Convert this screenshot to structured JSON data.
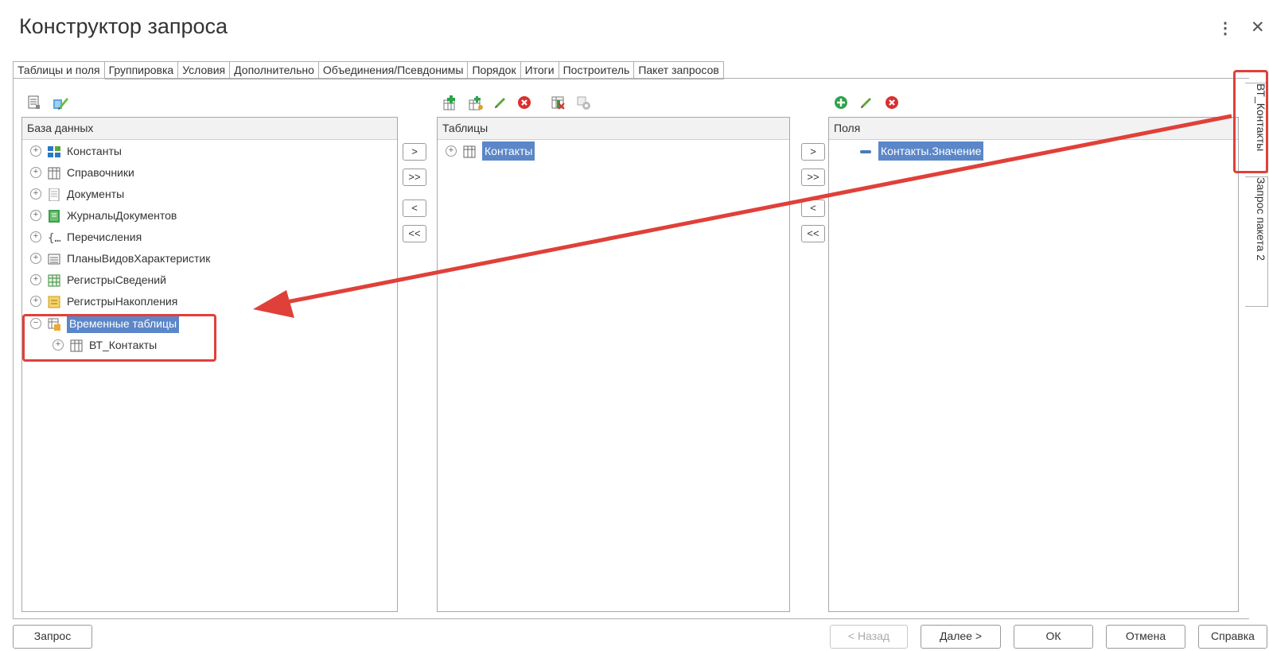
{
  "window": {
    "title": "Конструктор запроса"
  },
  "tabs": [
    {
      "label": "Таблицы и поля"
    },
    {
      "label": "Группировка"
    },
    {
      "label": "Условия"
    },
    {
      "label": "Дополнительно"
    },
    {
      "label": "Объединения/Псевдонимы"
    },
    {
      "label": "Порядок"
    },
    {
      "label": "Итоги"
    },
    {
      "label": "Построитель"
    },
    {
      "label": "Пакет запросов"
    }
  ],
  "database_panel": {
    "header": "База данных",
    "items": [
      {
        "label": "Константы",
        "icon": "constants-icon"
      },
      {
        "label": "Справочники",
        "icon": "catalog-icon"
      },
      {
        "label": "Документы",
        "icon": "document-icon"
      },
      {
        "label": "ЖурналыДокументов",
        "icon": "journal-icon"
      },
      {
        "label": "Перечисления",
        "icon": "enum-icon"
      },
      {
        "label": "ПланыВидовХарактеристик",
        "icon": "characteristics-icon"
      },
      {
        "label": "РегистрыСведений",
        "icon": "info-register-icon"
      },
      {
        "label": "РегистрыНакопления",
        "icon": "accum-register-icon"
      },
      {
        "label": "Временные таблицы",
        "icon": "temp-tables-icon",
        "expanded": true,
        "selected": true
      },
      {
        "label": "ВТ_Контакты",
        "icon": "table-icon",
        "child": true
      }
    ]
  },
  "tables_panel": {
    "header": "Таблицы",
    "items": [
      {
        "label": "Контакты",
        "selected": true
      }
    ]
  },
  "fields_panel": {
    "header": "Поля",
    "items": [
      {
        "label": "Контакты.Значение",
        "selected": true
      }
    ]
  },
  "transfer_buttons": {
    "add": ">",
    "add_all": ">>",
    "remove": "<",
    "remove_all": "<<"
  },
  "side_tabs": [
    {
      "label": "ВТ_Контакты",
      "active": true
    },
    {
      "label": "Запрос пакета 2"
    }
  ],
  "footer": {
    "query": "Запрос",
    "back": "< Назад",
    "next": "Далее >",
    "ok": "ОК",
    "cancel": "Отмена",
    "help": "Справка"
  },
  "colors": {
    "selection": "#5b87c9",
    "annotation": "#e0403a"
  }
}
